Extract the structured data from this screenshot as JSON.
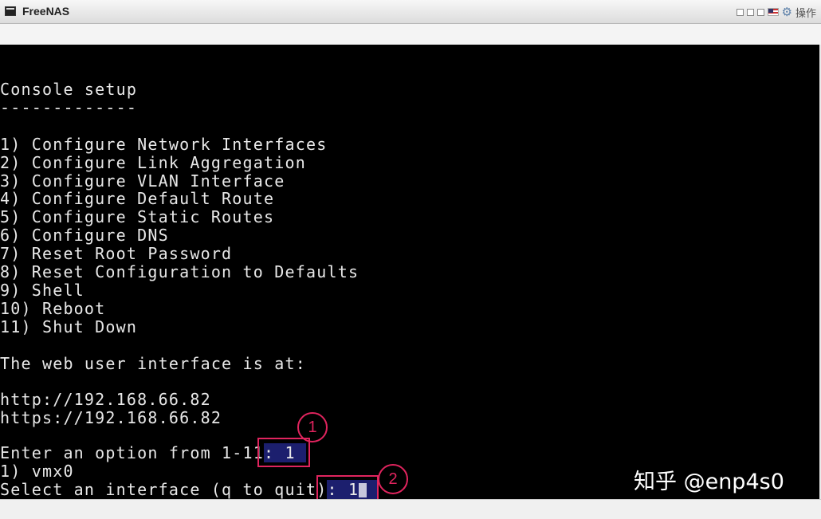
{
  "window": {
    "title": "FreeNAS",
    "action_label": "操作",
    "icons": [
      "restore-icon",
      "minimize-icon",
      "maximize-icon",
      "flag-icon",
      "gear-icon"
    ]
  },
  "console": {
    "lines": [
      "Console setup",
      "-------------",
      "",
      "1) Configure Network Interfaces",
      "2) Configure Link Aggregation",
      "3) Configure VLAN Interface",
      "4) Configure Default Route",
      "5) Configure Static Routes",
      "6) Configure DNS",
      "7) Reset Root Password",
      "8) Reset Configuration to Defaults",
      "9) Shell",
      "10) Reboot",
      "11) Shut Down",
      "",
      "The web user interface is at:",
      "",
      "http://192.168.66.82",
      "https://192.168.66.82",
      ""
    ],
    "prompt1": {
      "text": "Enter an option from 1-11",
      "answer": ": 1 "
    },
    "iface_line": "1) vmx0",
    "prompt2": {
      "text": "Select an interface (q to quit)",
      "answer": ": 1"
    }
  },
  "annotations": {
    "badge1": "1",
    "badge2": "2"
  },
  "watermark": "知乎 @enp4s0",
  "colors": {
    "annotation": "#e0245e",
    "highlight": "#1c1f6e",
    "console_bg": "#000000"
  }
}
